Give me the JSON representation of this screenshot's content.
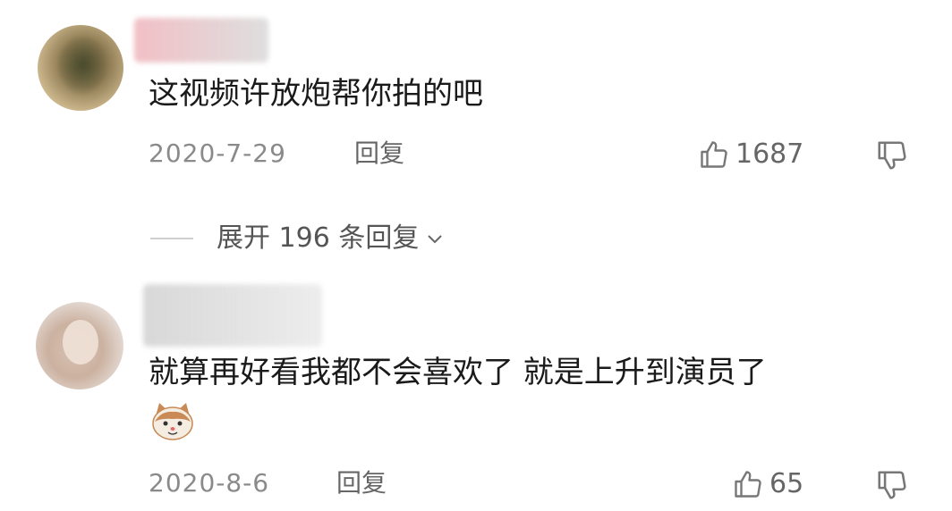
{
  "comments": [
    {
      "text": "这视频许放炮帮你拍的吧",
      "date": "2020-7-29",
      "reply_label": "回复",
      "likes": "1687"
    },
    {
      "text": "就算再好看我都不会喜欢了 就是上升到演员了",
      "date": "2020-8-6",
      "reply_label": "回复",
      "likes": "65"
    }
  ],
  "expand_replies": {
    "label": "展开 196 条回复"
  },
  "icons": {
    "like": "thumbs-up-icon",
    "dislike": "thumbs-down-icon",
    "expand": "chevron-down-icon",
    "emoji": "cat-face-emoji"
  }
}
